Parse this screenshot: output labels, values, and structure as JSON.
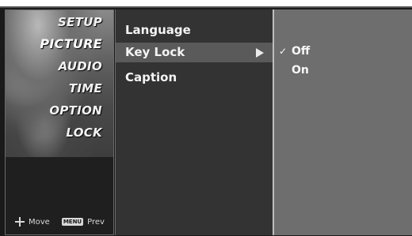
{
  "categories": [
    {
      "label": "SETUP"
    },
    {
      "label": "PICTURE"
    },
    {
      "label": "AUDIO"
    },
    {
      "label": "TIME"
    },
    {
      "label": "OPTION"
    },
    {
      "label": "LOCK"
    }
  ],
  "selected_category": "PICTURE",
  "hints": {
    "move_label": "Move",
    "menu_key": "MENU",
    "prev_label": "Prev"
  },
  "submenu": [
    {
      "label": "Language"
    },
    {
      "label": "Key Lock"
    },
    {
      "label": "Caption"
    }
  ],
  "selected_submenu": "Key Lock",
  "options": [
    {
      "label": "Off",
      "checked": true
    },
    {
      "label": "On",
      "checked": false
    }
  ],
  "icons": {
    "check": "check-icon",
    "arrow": "arrow-right-icon",
    "move": "move-icon"
  }
}
